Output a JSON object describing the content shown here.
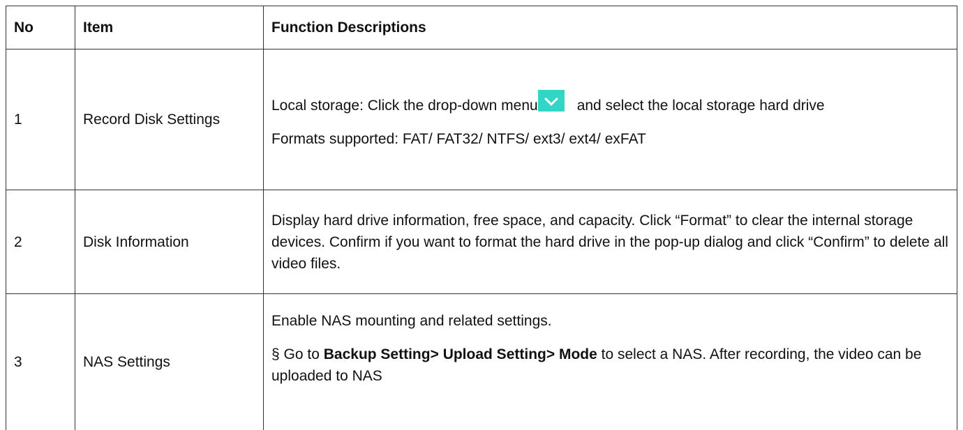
{
  "table": {
    "headers": {
      "no": "No",
      "item": "Item",
      "description": "Function Descriptions"
    },
    "rows": [
      {
        "no": "1",
        "item": "Record Disk Settings",
        "description": {
          "p1_before_icon": "Local storage: Click the drop-down menu",
          "p1_after_icon": "and select the local storage hard drive",
          "p2": "Formats supported: FAT/ FAT32/ NTFS/ ext3/ ext4/ exFAT",
          "icon": "chevron-down-icon"
        }
      },
      {
        "no": "2",
        "item": "Disk Information",
        "description": {
          "p1": "Display hard drive information, free space, and capacity. Click “Format” to clear the internal storage devices. Confirm if you want to format the hard drive in the pop-up dialog and click “Confirm” to delete all video files."
        }
      },
      {
        "no": "3",
        "item": "NAS Settings",
        "description": {
          "p1": "Enable NAS mounting and related settings.",
          "p2_prefix": "§ Go to",
          "p2_path": "Backup Setting> Upload Setting> Mode",
          "p2_suffix": "to select a NAS. After recording, the video can be uploaded to NAS"
        }
      }
    ]
  },
  "colors": {
    "border": "#333333",
    "icon_background": "#33d6c6",
    "icon_glyph": "#ffffff",
    "text": "#111111"
  }
}
